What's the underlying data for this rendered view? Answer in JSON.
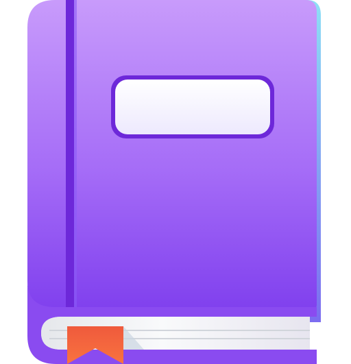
{
  "icon": {
    "name": "book-icon",
    "colors": {
      "cover_top": "#c084fc",
      "cover_bottom": "#7c3aed",
      "cover_mid": "#9b5cf6",
      "spine_line": "#6d28d9",
      "edge_tint": "#7dd3fc",
      "label_fill": "#f5f3ff",
      "label_border": "#6d28d9",
      "pages": "#f3f4f6",
      "bookmark": "#ea580c"
    }
  }
}
